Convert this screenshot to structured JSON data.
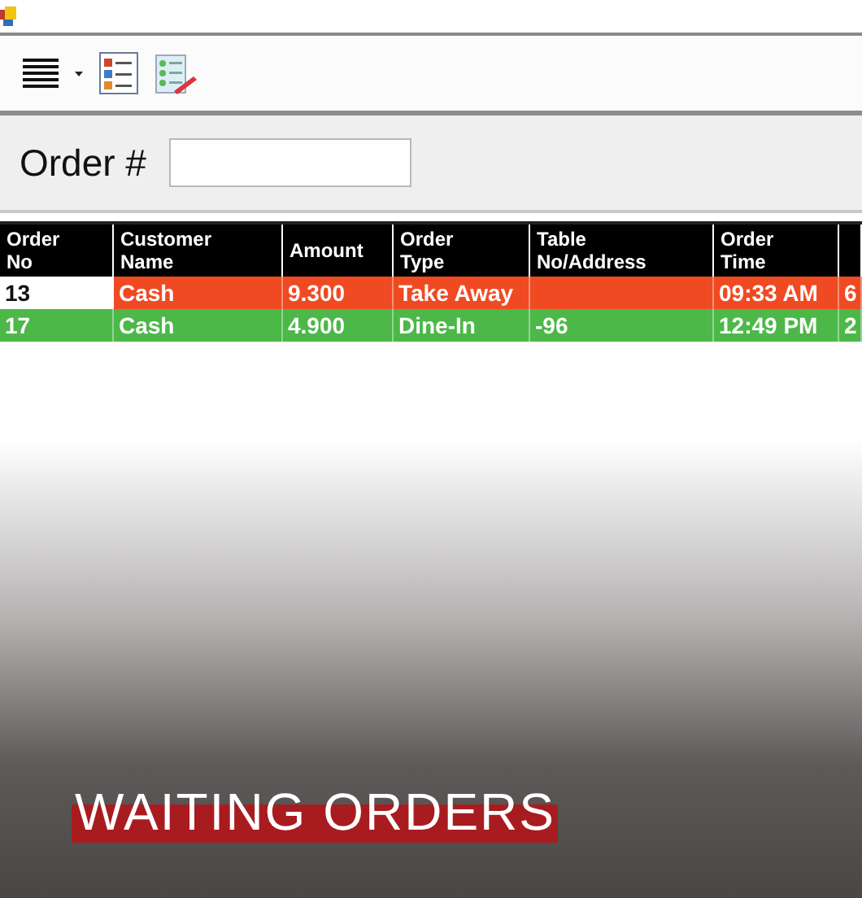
{
  "filter": {
    "label": "Order #"
  },
  "table": {
    "columns": [
      "Order\nNo",
      "Customer\nName",
      "Amount",
      "Order\nType",
      "Table\nNo/Address",
      "Order\nTime",
      ""
    ],
    "rows": [
      {
        "color": "#f04a23",
        "current": true,
        "cells": [
          "13",
          "Cash",
          "9.300",
          "Take Away",
          "",
          "09:33 AM",
          "6"
        ]
      },
      {
        "color": "#4cb848",
        "current": false,
        "cells": [
          "17",
          "Cash",
          "4.900",
          "Dine-In",
          "-96",
          "12:49 PM",
          "2"
        ]
      }
    ]
  },
  "banner": {
    "title": "WAITING ORDERS"
  }
}
